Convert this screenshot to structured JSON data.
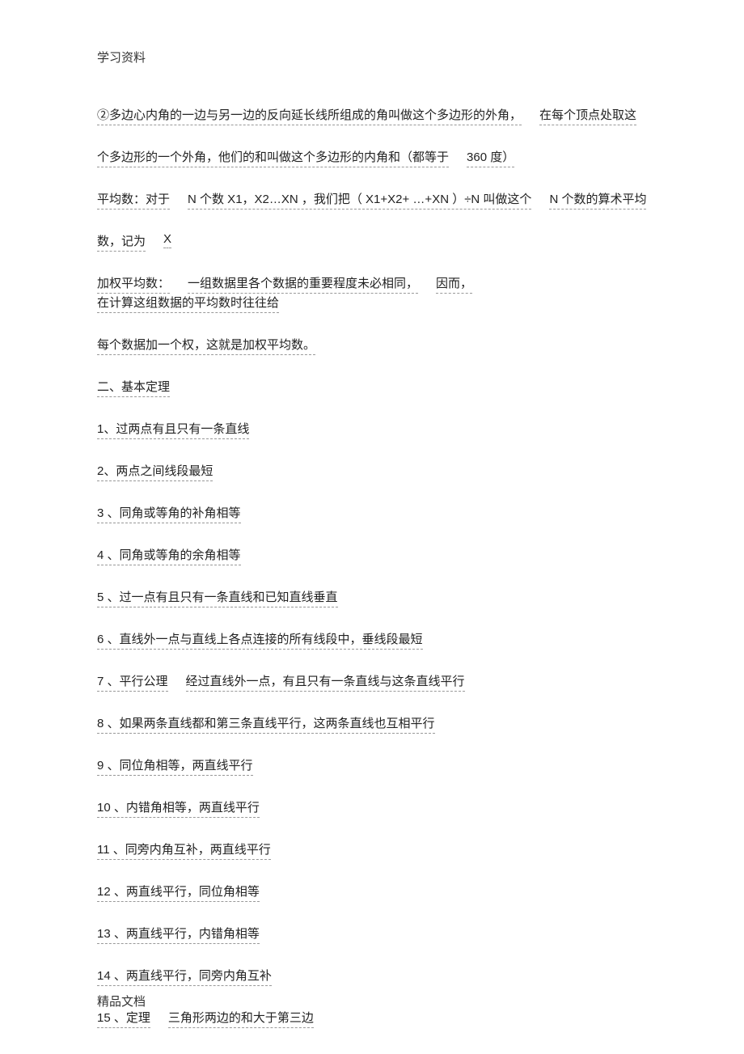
{
  "header": "学习资料",
  "footer": "精品文档",
  "r1": {
    "a": "②多边心内角的一边与另一边的反向延长线所组成的角叫做这个多边形的外角，",
    "b": "在每个顶点处取这"
  },
  "r2": {
    "a": "个多边形的一个外角，他们的和叫做这个多边形的内角和（都等于",
    "b": "360 度）"
  },
  "r3": {
    "a": "平均数：对于",
    "b": "N 个数 X1，X2…XN ，我们把（ X1+X2+ …+XN ）÷N 叫做这个",
    "c": "N 个数的算术平均"
  },
  "r4": {
    "a": "数，记为",
    "b": "X"
  },
  "r5": {
    "a": "加权平均数：",
    "b": "一组数据里各个数据的重要程度未必相同，",
    "c": "因而，",
    "d": "在计算这组数据的平均数时往往给"
  },
  "r6": {
    "a": "每个数据加一个权，这就是加权平均数。"
  },
  "s1": "二、基本定理",
  "s2": "1、过两点有且只有一条直线",
  "s3": "2、两点之间线段最短",
  "s4": "3 、同角或等角的补角相等",
  "s5": "4 、同角或等角的余角相等",
  "s6": "5 、过一点有且只有一条直线和已知直线垂直",
  "s7": "6 、直线外一点与直线上各点连接的所有线段中，垂线段最短",
  "s8_a": "7 、平行公理",
  "s8_b": "经过直线外一点，有且只有一条直线与这条直线平行",
  "s9": "8 、如果两条直线都和第三条直线平行，这两条直线也互相平行",
  "s10": "9 、同位角相等，两直线平行",
  "s11": "10 、内错角相等，两直线平行",
  "s12": "11 、同旁内角互补，两直线平行",
  "s13": "12 、两直线平行，同位角相等",
  "s14": "13 、两直线平行，内错角相等",
  "s15": "14 、两直线平行，同旁内角互补",
  "s16_a": "15 、定理",
  "s16_b": "三角形两边的和大于第三边"
}
